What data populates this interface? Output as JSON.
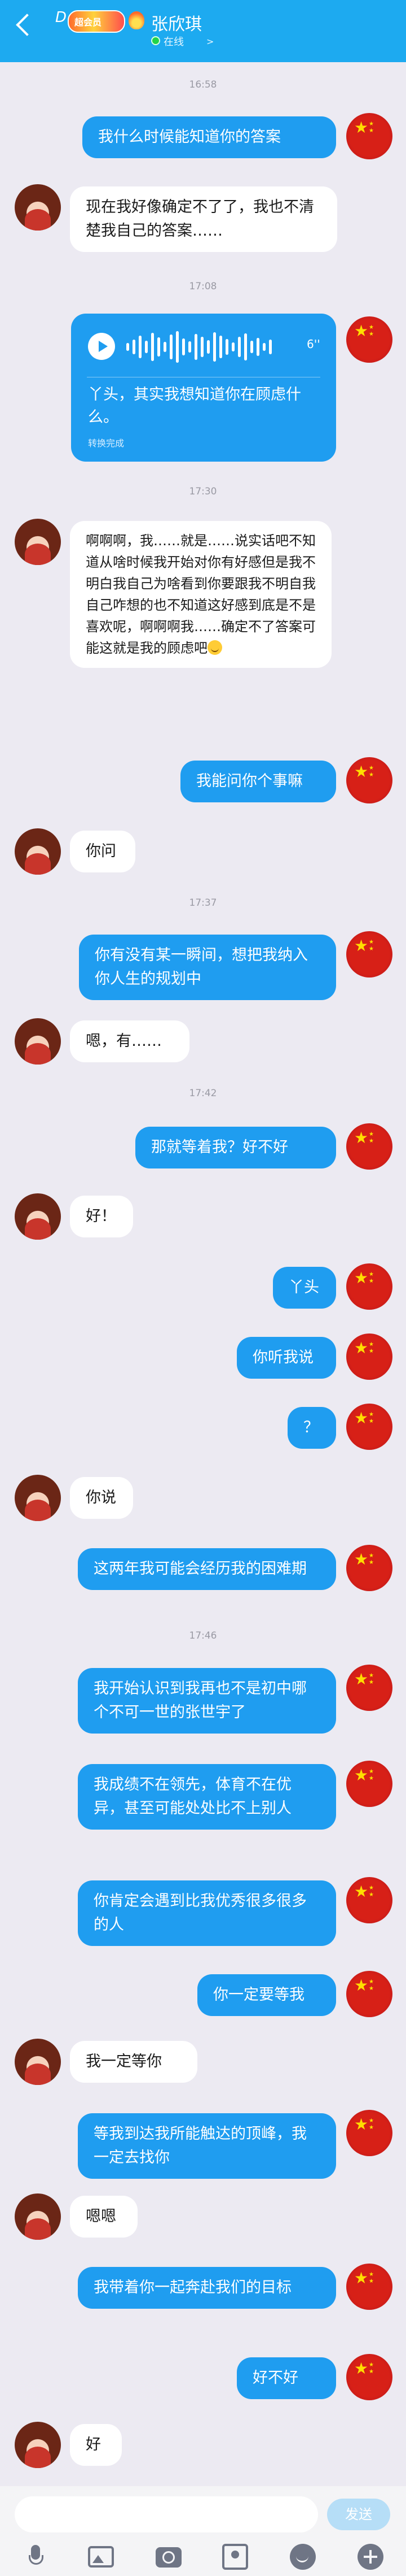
{
  "header": {
    "prefix": "D",
    "badge": "超会员",
    "name": "张欣琪",
    "status": "在线",
    "status_arrow": ">"
  },
  "messages": [
    {
      "type": "time",
      "text": "16:58"
    },
    {
      "type": "right",
      "text": "我什么时候能知道你的答案"
    },
    {
      "type": "left",
      "text": "现在我好像确定不了了，我也不清楚我自己的答案……"
    },
    {
      "type": "time",
      "text": "17:08"
    },
    {
      "type": "voice",
      "duration": "6''",
      "text": "丫头，其实我想知道你在顾虑什么。",
      "source": "转换完成"
    },
    {
      "type": "time",
      "text": "17:30"
    },
    {
      "type": "left",
      "text": "啊啊啊，我……就是……说实话吧不知道从啥时候我开始对你有好感但是我不明白我自己为啥看到你要跟我不明自我自己咋想的也不知道这好感到底是不是喜欢呢，啊啊啊我……确定不了答案可能这就是我的顾虑吧"
    },
    {
      "type": "right",
      "text": "我能问你个事嘛"
    },
    {
      "type": "left",
      "text": "你问"
    },
    {
      "type": "time",
      "text": "17:37"
    },
    {
      "type": "right",
      "text": "你有没有某一瞬间，想把我纳入你人生的规划中"
    },
    {
      "type": "left",
      "text": "嗯，有……"
    },
    {
      "type": "time",
      "text": "17:42"
    },
    {
      "type": "right",
      "text": "那就等着我？好不好"
    },
    {
      "type": "left",
      "text": "好！"
    },
    {
      "type": "right",
      "text": "丫头"
    },
    {
      "type": "right",
      "text": "你听我说"
    },
    {
      "type": "right",
      "text": "？"
    },
    {
      "type": "left",
      "text": "你说"
    },
    {
      "type": "right",
      "text": "这两年我可能会经历我的困难期"
    },
    {
      "type": "time",
      "text": "17:46"
    },
    {
      "type": "right",
      "text": "我开始认识到我再也不是初中哪个不可一世的张世宇了"
    },
    {
      "type": "right",
      "text": "我成绩不在领先，体育不在优异，甚至可能处处比不上别人"
    },
    {
      "type": "right",
      "text": "你肯定会遇到比我优秀很多很多的人"
    },
    {
      "type": "right",
      "text": "你一定要等我"
    },
    {
      "type": "left",
      "text": "我一定等你"
    },
    {
      "type": "right",
      "text": "等我到达我所能触达的顶峰，我一定去找你"
    },
    {
      "type": "left",
      "text": "嗯嗯"
    },
    {
      "type": "right",
      "text": "我带着你一起奔赴我们的目标"
    },
    {
      "type": "right",
      "text": "好不好"
    },
    {
      "type": "left",
      "text": "好"
    }
  ],
  "input": {
    "placeholder": "",
    "send_label": "发送"
  },
  "toolbar": [
    "microphone-icon",
    "image-icon",
    "camera-icon",
    "red-packet-icon",
    "emoji-icon",
    "plus-icon"
  ]
}
